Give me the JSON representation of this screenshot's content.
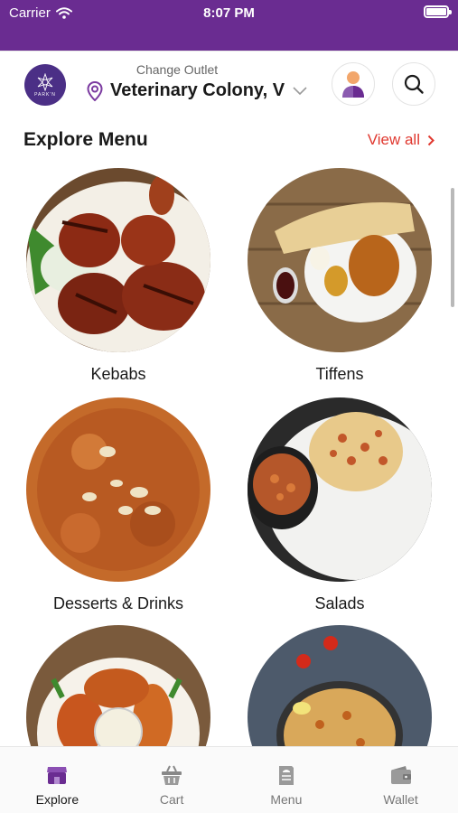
{
  "status_bar": {
    "carrier": "Carrier",
    "time": "8:07 PM"
  },
  "header": {
    "logo_text": "PARK'N",
    "outlet_caption": "Change Outlet",
    "outlet_name": "Veterinary Colony, V"
  },
  "section": {
    "title": "Explore Menu",
    "view_all": "View all"
  },
  "categories": [
    {
      "label": "Kebabs"
    },
    {
      "label": "Tiffens"
    },
    {
      "label": "Desserts & Drinks"
    },
    {
      "label": "Salads"
    },
    {
      "label": ""
    },
    {
      "label": ""
    }
  ],
  "tabbar": {
    "tabs": [
      {
        "label": "Explore",
        "icon": "store-icon",
        "active": true
      },
      {
        "label": "Cart",
        "icon": "basket-icon",
        "active": false
      },
      {
        "label": "Menu",
        "icon": "menu-book-icon",
        "active": false
      },
      {
        "label": "Wallet",
        "icon": "wallet-icon",
        "active": false
      }
    ]
  },
  "colors": {
    "brand_purple": "#6a2c91",
    "accent_red": "#e0382f"
  }
}
